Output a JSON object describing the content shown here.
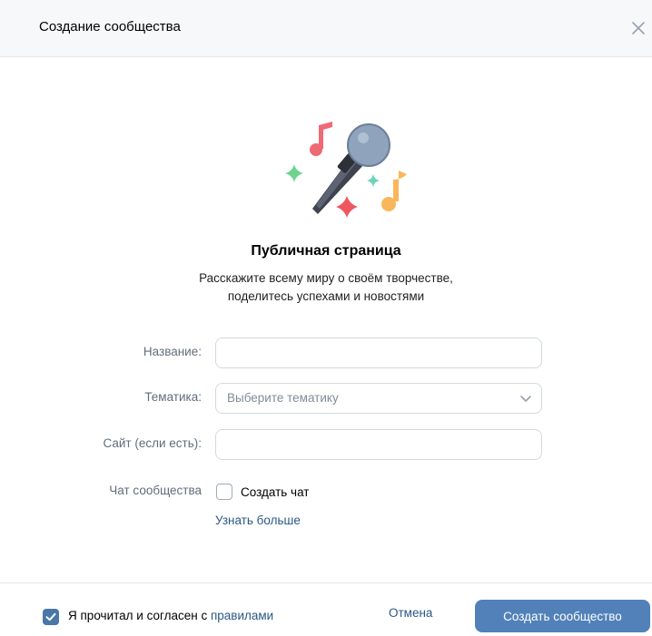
{
  "header": {
    "title": "Создание сообщества"
  },
  "intro": {
    "heading": "Публичная страница",
    "description_line1": "Расскажите всему миру о своём творчестве,",
    "description_line2": "поделитесь успехами и новостями"
  },
  "form": {
    "name_label": "Название:",
    "name_value": "",
    "topic_label": "Тематика:",
    "topic_placeholder": "Выберите тематику",
    "site_label": "Сайт (если есть):",
    "site_value": "",
    "chat_label": "Чат сообщества",
    "create_chat_label": "Создать чат",
    "create_chat_checked": false,
    "learn_more_link": "Узнать больше"
  },
  "footer": {
    "agree_text": "Я прочитал и согласен с ",
    "rules_link": "правилами",
    "agree_checked": true,
    "cancel_label": "Отмена",
    "create_label": "Создать сообщество"
  },
  "colors": {
    "accent": "#5181b8",
    "link": "#2a5885",
    "checkbox_checked": "#4a76a8"
  }
}
